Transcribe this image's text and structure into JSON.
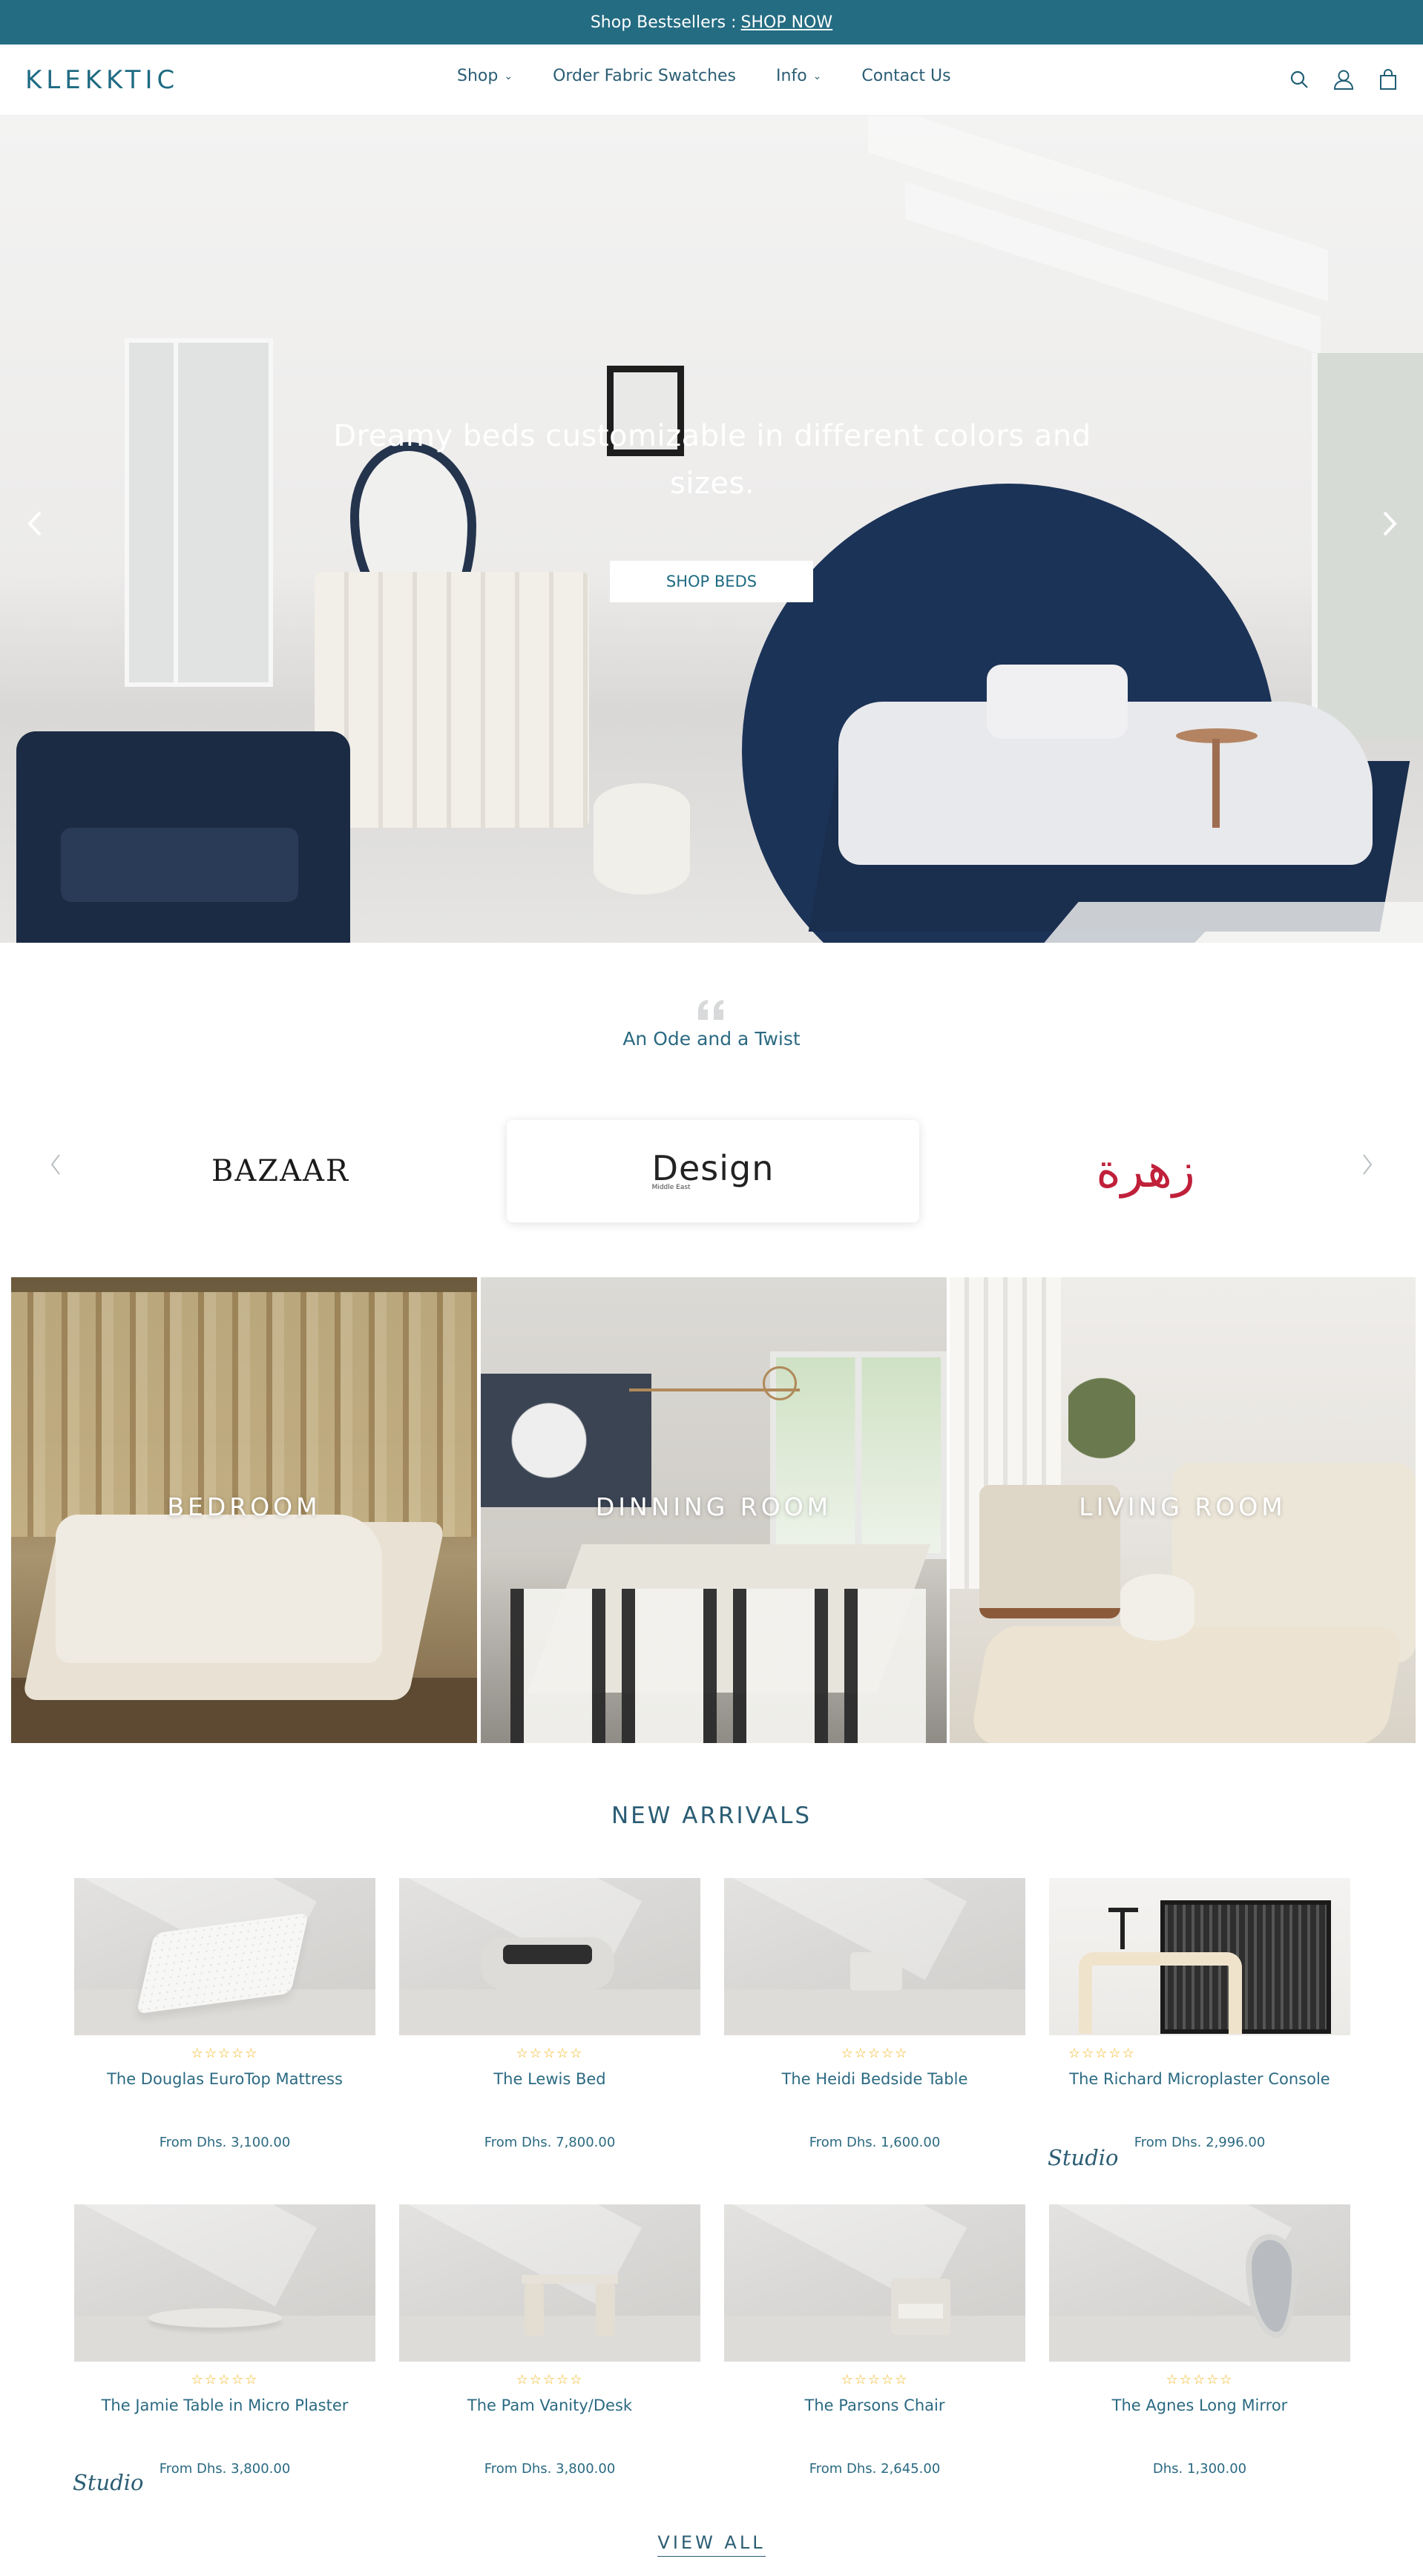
{
  "announcement": {
    "text": "Shop Bestsellers :",
    "link": "SHOP NOW"
  },
  "header": {
    "logo": "KLEKKTIC",
    "nav": [
      {
        "label": "Shop",
        "dropdown": true
      },
      {
        "label": "Order Fabric Swatches",
        "dropdown": false
      },
      {
        "label": "Info",
        "dropdown": true
      },
      {
        "label": "Contact Us",
        "dropdown": false
      }
    ],
    "icons": [
      "search-icon",
      "account-icon",
      "cart-icon"
    ]
  },
  "hero": {
    "title": "Dreamy beds customizable in different colors and sizes.",
    "button": "SHOP BEDS"
  },
  "press": {
    "quote": "An Ode and a Twist",
    "logos": [
      {
        "text": "BAZAAR"
      },
      {
        "text": "Design",
        "sub": "Middle East"
      },
      {
        "text": "زهرة"
      }
    ]
  },
  "rooms": [
    {
      "label": "BEDROOM"
    },
    {
      "label": "DINNING ROOM"
    },
    {
      "label": "LIVING ROOM"
    }
  ],
  "new_arrivals": {
    "title": "NEW ARRIVALS",
    "rating_stars": "☆☆☆☆☆",
    "studio_badge": "Studio",
    "products": [
      {
        "name": "The Douglas EuroTop Mattress",
        "price": "From Dhs. 3,100.00"
      },
      {
        "name": "The Lewis Bed",
        "price": "From Dhs. 7,800.00"
      },
      {
        "name": "The Heidi Bedside Table",
        "price": "From Dhs. 1,600.00"
      },
      {
        "name": "The Richard Microplaster Console",
        "price": "From Dhs. 2,996.00"
      },
      {
        "name": "The Jamie Table in Micro Plaster",
        "price": "From Dhs. 3,800.00"
      },
      {
        "name": "The Pam Vanity/Desk",
        "price": "From Dhs. 3,800.00"
      },
      {
        "name": "The Parsons Chair",
        "price": "From Dhs. 2,645.00"
      },
      {
        "name": "The Agnes Long Mirror",
        "price": "Dhs. 1,300.00"
      }
    ],
    "view_all": "VIEW ALL"
  },
  "colors": {
    "brand": "#246c82",
    "text": "#2b5d74",
    "star": "#f2b51d"
  }
}
